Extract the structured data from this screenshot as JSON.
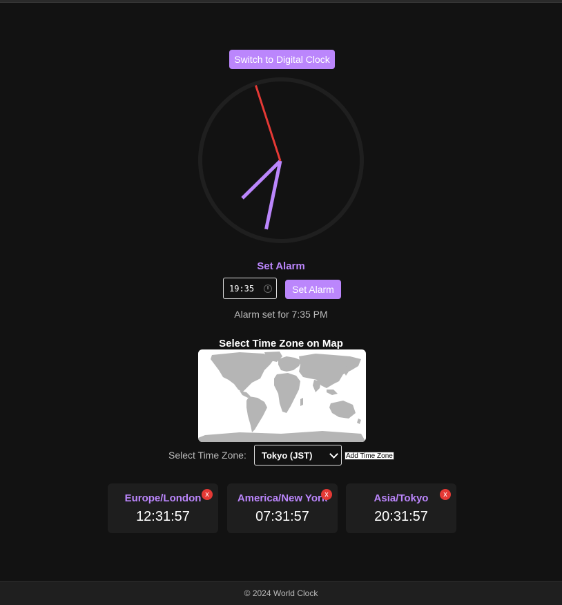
{
  "toggle_button_label": "Switch to Digital Clock",
  "analog_clock": {
    "hour": 7,
    "minute": 31,
    "second": 57
  },
  "alarm": {
    "title": "Set Alarm",
    "input_value": "19:35",
    "button_label": "Set Alarm",
    "status": "Alarm set for 7:35 PM"
  },
  "map": {
    "title": "Select Time Zone on Map"
  },
  "timezone_picker": {
    "label": "Select Time Zone:",
    "selected": "Tokyo (JST)",
    "add_button_label": "Add Time Zone"
  },
  "clocks": [
    {
      "name": "Europe/London",
      "time": "12:31:57",
      "remove": "x"
    },
    {
      "name": "America/New York",
      "time": "07:31:57",
      "remove": "x"
    },
    {
      "name": "Asia/Tokyo",
      "time": "20:31:57",
      "remove": "x"
    }
  ],
  "footer": "© 2024 World Clock",
  "colors": {
    "background": "#121212",
    "accent": "#bb86fc",
    "second_hand": "#e53935",
    "card": "#1e1e1e",
    "remove": "#e53935"
  }
}
